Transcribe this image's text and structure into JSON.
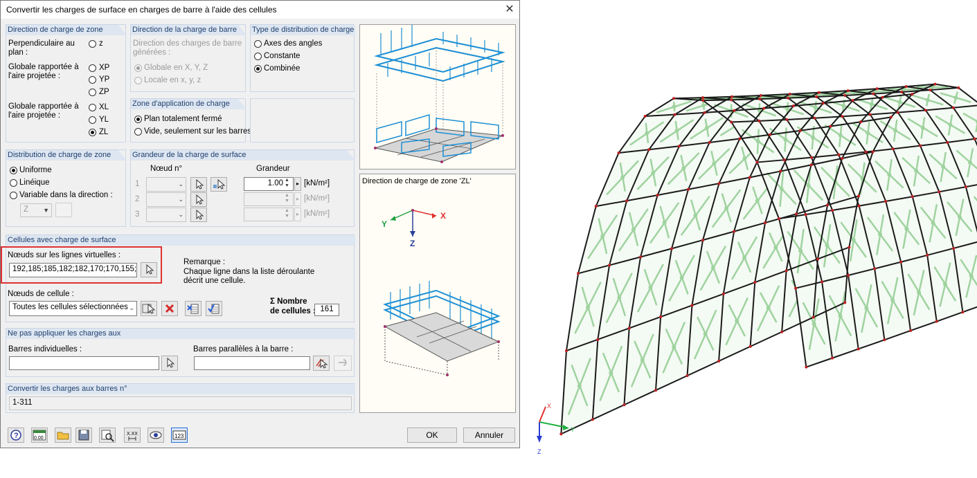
{
  "window": {
    "title": "Convertir les charges de surface en charges de barre à l'aide des cellules",
    "close": "✕"
  },
  "direction_zone": {
    "header": "Direction de charge de zone",
    "perp_label": "Perpendiculaire au plan :",
    "opt_z": "z",
    "globale_proj_label": "Globale rapportée à l'aire projetée :",
    "opt_xp": "XP",
    "opt_yp": "YP",
    "opt_zp": "ZP",
    "globale_label": "Globale rapportée à l'aire projetée :",
    "opt_xl": "XL",
    "opt_yl": "YL",
    "opt_zl": "ZL"
  },
  "direction_barre": {
    "header": "Direction de la charge de barre",
    "desc": "Direction des charges de barre générées :",
    "opt_global": "Globale en X, Y, Z",
    "opt_local": "Locale en x, y, z"
  },
  "type_distribution": {
    "header": "Type de distribution de charge",
    "opt_axes": "Axes des angles",
    "opt_constante": "Constante",
    "opt_combinee": "Combinée"
  },
  "zone_application": {
    "header": "Zone d'application de charge",
    "opt_plan": "Plan totalement fermé",
    "opt_vide": "Vide, seulement sur les barres"
  },
  "distribution_zone": {
    "header": "Distribution de charge de zone",
    "opt_uniforme": "Uniforme",
    "opt_lineique": "Linéique",
    "opt_variable": "Variable dans la direction :",
    "dir_value": "Z"
  },
  "grandeur": {
    "header": "Grandeur de la charge de surface",
    "col_noeud": "Nœud n°",
    "col_grandeur": "Grandeur",
    "rows": [
      {
        "n": "1",
        "value": "1.00",
        "unit": "[kN/m²]"
      },
      {
        "n": "2",
        "value": "",
        "unit": "[kN/m²]"
      },
      {
        "n": "3",
        "value": "",
        "unit": "[kN/m²]"
      }
    ]
  },
  "cellules": {
    "header": "Cellules avec charge de surface",
    "noeuds_label": "Nœuds sur les lignes virtuelles :",
    "noeuds_value": "192,185;185,182;182,170;170,155;",
    "remarque_title": "Remarque :",
    "remarque_text1": "Chaque ligne dans la liste déroulante",
    "remarque_text2": "décrit une cellule.",
    "cell_nodes_label": "Nœuds de cellule :",
    "cell_nodes_value": "Toutes les cellules sélectionnées",
    "sum_label1": "Σ Nombre",
    "sum_label2": "de cellules :",
    "sum_value": "161"
  },
  "ne_pas_appliquer": {
    "header": "Ne pas appliquer les charges aux",
    "barres_ind_label": "Barres individuelles :",
    "barres_par_label": "Barres parallèles à la barre :",
    "barres_ind_value": "",
    "barres_par_value": ""
  },
  "convertir": {
    "header": "Convertir les charges aux barres n°",
    "value": "1-311"
  },
  "preview": {
    "caption": "Direction de charge de zone 'ZL'",
    "axis_x": "X",
    "axis_y": "Y",
    "axis_z": "Z"
  },
  "footer": {
    "ok": "OK",
    "cancel": "Annuler",
    "zero_label": "0.00",
    "xxx_label": "X.XX",
    "num_label": "123"
  },
  "model_view": {
    "axis_x": "X",
    "axis_y": "Y",
    "axis_z": "Z"
  },
  "colors": {
    "accent": "#1f3f6e",
    "highlight": "#e03030",
    "load": "#1c8fd6",
    "surface_load": "#9fd39f"
  }
}
